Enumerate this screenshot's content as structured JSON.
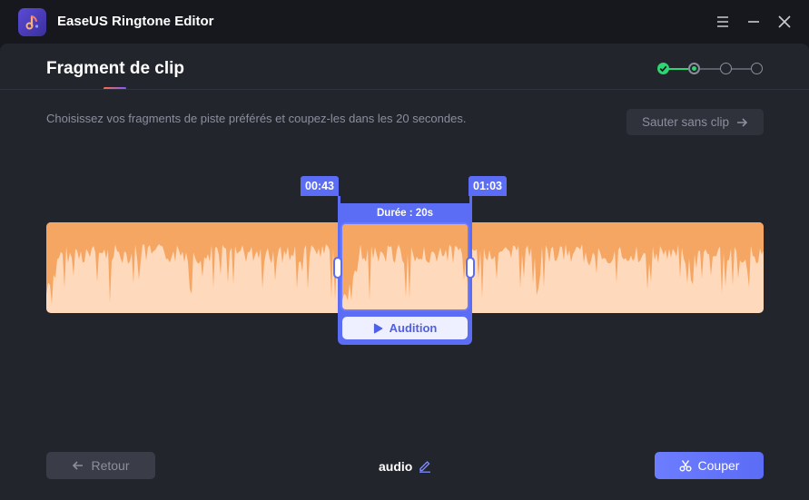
{
  "app": {
    "title": "EaseUS Ringtone Editor"
  },
  "window_controls": [
    {
      "name": "menu-icon"
    },
    {
      "name": "minimize-icon"
    },
    {
      "name": "close-icon"
    }
  ],
  "page": {
    "title": "Fragment de clip",
    "instruction": "Choisissez vos fragments de piste préférés et coupez-les dans les 20 secondes.",
    "skip_label": "Sauter sans clip"
  },
  "stepper": {
    "steps": [
      "done",
      "current",
      "pending",
      "pending"
    ],
    "accent": "#2ed573"
  },
  "clip": {
    "start_time": "00:43",
    "end_time": "01:03",
    "duration_label": "Durée : 20s",
    "audition_label": "Audition"
  },
  "footer": {
    "back_label": "Retour",
    "filename": "audio",
    "cut_label": "Couper"
  },
  "colors": {
    "accent": "#5b6cf5",
    "waveform_fill": "#f5a662",
    "waveform_bg": "#ffd9bb",
    "panel": "#23252d"
  }
}
